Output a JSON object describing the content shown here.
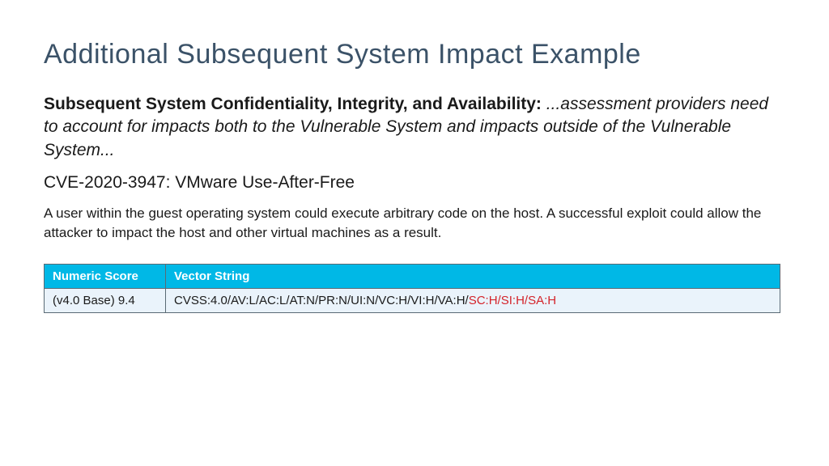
{
  "title": "Additional Subsequent System Impact Example",
  "lead_bold": "Subsequent System Confidentiality, Integrity, and Availability:",
  "lead_ital": "...assessment providers need to account for impacts both to the Vulnerable System and impacts outside of the Vulnerable System...",
  "cve_heading": "CVE-2020-3947: VMware Use-After-Free",
  "description": "A user within the guest operating system could execute arbitrary code on the host. A successful exploit could allow the attacker to impact the host and other virtual machines as a result.",
  "table": {
    "headers": {
      "score": "Numeric Score",
      "vector": "Vector String"
    },
    "row": {
      "score": "(v4.0 Base) 9.4",
      "vector_main": "CVSS:4.0/AV:L/AC:L/AT:N/PR:N/UI:N/VC:H/VI:H/VA:H/",
      "vector_highlight": "SC:H/SI:H/SA:H"
    }
  }
}
